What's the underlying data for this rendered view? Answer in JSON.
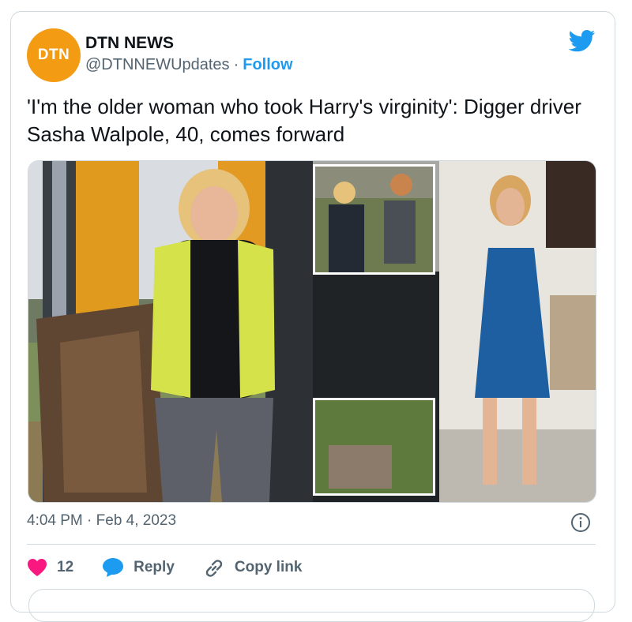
{
  "author": {
    "display_name": "DTN NEWS",
    "handle": "@DTNNEWUpdates",
    "separator": "·",
    "follow_label": "Follow",
    "avatar_text": "DTN"
  },
  "tweet": {
    "text": "'I'm the older woman who took Harry's virginity': Digger driver Sasha Walpole, 40, comes forward",
    "timestamp": "4:04 PM · Feb 4, 2023"
  },
  "actions": {
    "like_count": "12",
    "reply_label": "Reply",
    "copy_link_label": "Copy link"
  },
  "colors": {
    "brand_blue": "#1d9bf0",
    "like_pink": "#f91880",
    "avatar_orange": "#f39b13",
    "secondary_text": "#536471",
    "border": "#cfd9de"
  },
  "icons": [
    "twitter-bird-icon",
    "info-icon",
    "heart-icon",
    "reply-bubble-icon",
    "link-icon"
  ]
}
